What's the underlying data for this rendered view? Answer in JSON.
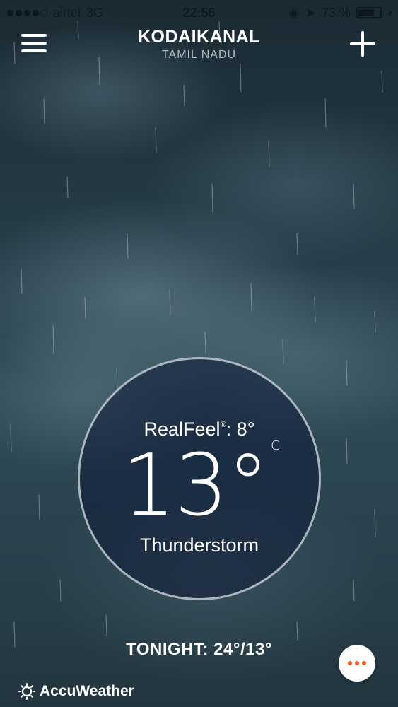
{
  "status_bar": {
    "carrier": "airtel",
    "network": "3G",
    "time": "22:56",
    "battery_text": "73 %",
    "battery_level": 0.73,
    "signal_bars_filled": 4,
    "signal_bars_total": 5
  },
  "header": {
    "city": "KODAIKANAL",
    "state": "TAMIL NADU",
    "menu_icon": "hamburger-menu-icon",
    "add_icon": "plus-icon"
  },
  "current": {
    "realfeel_label": "RealFeel",
    "realfeel_mark": "®",
    "realfeel_value": ": 8°",
    "temperature": "13°",
    "unit": "C",
    "condition": "Thunderstorm"
  },
  "forecast": {
    "tonight": "TONIGHT: 24°/13°"
  },
  "footer": {
    "brand": "AccuWeather",
    "more_icon": "more-dots-icon"
  },
  "colors": {
    "accent": "#f05a28",
    "circle_fill": "#0f1937"
  }
}
